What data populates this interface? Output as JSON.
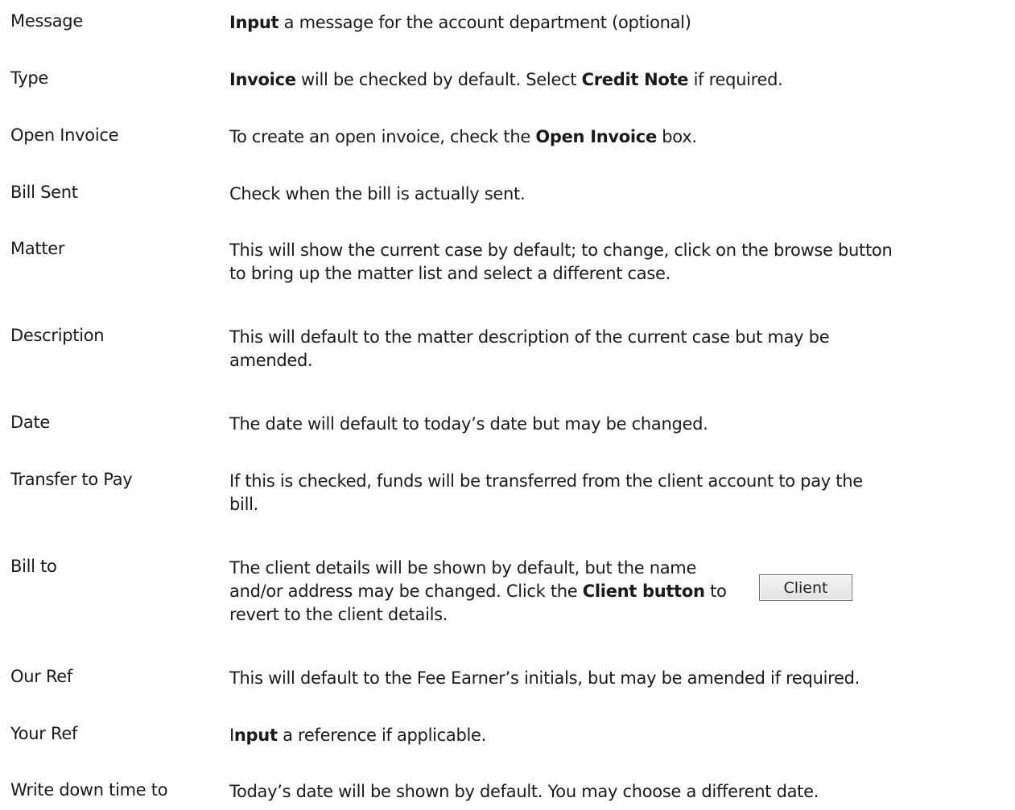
{
  "rows": [
    {
      "term": "Message",
      "parts": [
        {
          "b": "Input"
        },
        {
          "t": " a message for the account department (optional)"
        }
      ]
    },
    {
      "term": "Type",
      "parts": [
        {
          "b": "Invoice"
        },
        {
          "t": " will be checked by default. Select "
        },
        {
          "b": "Credit Note"
        },
        {
          "t": " if required."
        }
      ]
    },
    {
      "term": "Open Invoice",
      "parts": [
        {
          "t": "To create an open invoice, check the "
        },
        {
          "b": "Open Invoice"
        },
        {
          "t": " box."
        }
      ]
    },
    {
      "term": "Bill Sent",
      "parts": [
        {
          "t": "Check when the bill is actually sent."
        }
      ]
    },
    {
      "term": "Matter",
      "lines": [
        [
          {
            "t": "This will show the current case by default; to change, click on the browse button"
          }
        ],
        [
          {
            "t": "to bring up the matter list and select a different case."
          }
        ]
      ]
    },
    {
      "term": "Description",
      "lines": [
        [
          {
            "t": "This will default to the matter description of the current case but may be"
          }
        ],
        [
          {
            "t": "amended."
          }
        ]
      ]
    },
    {
      "term": "Date",
      "parts": [
        {
          "t": "The date will default to today’s date but may be changed."
        }
      ]
    },
    {
      "term": "Transfer to Pay",
      "lines": [
        [
          {
            "t": "If this is checked, funds will be transferred from the client account to pay the"
          }
        ],
        [
          {
            "t": "bill."
          }
        ]
      ]
    },
    {
      "term": "Bill to",
      "lines": [
        [
          {
            "t": "The client details will be shown by default, but the name"
          }
        ],
        [
          {
            "t": "and/or address may be changed. Click the "
          },
          {
            "b": "Client button"
          },
          {
            "t": " to"
          }
        ],
        [
          {
            "t": "revert to the client details."
          }
        ]
      ]
    },
    {
      "term": "Our Ref",
      "parts": [
        {
          "t": "This will default to the Fee Earner’s initials, but may be amended if required."
        }
      ]
    },
    {
      "term": "Your Ref",
      "parts": [
        {
          "t": "I"
        },
        {
          "b": "nput"
        },
        {
          "t": " a reference if applicable."
        }
      ]
    },
    {
      "term": "Write down time to",
      "parts": [
        {
          "t": "Today’s date will be shown by default. You may choose a different date."
        }
      ]
    }
  ],
  "client_button": {
    "label": "Client"
  }
}
